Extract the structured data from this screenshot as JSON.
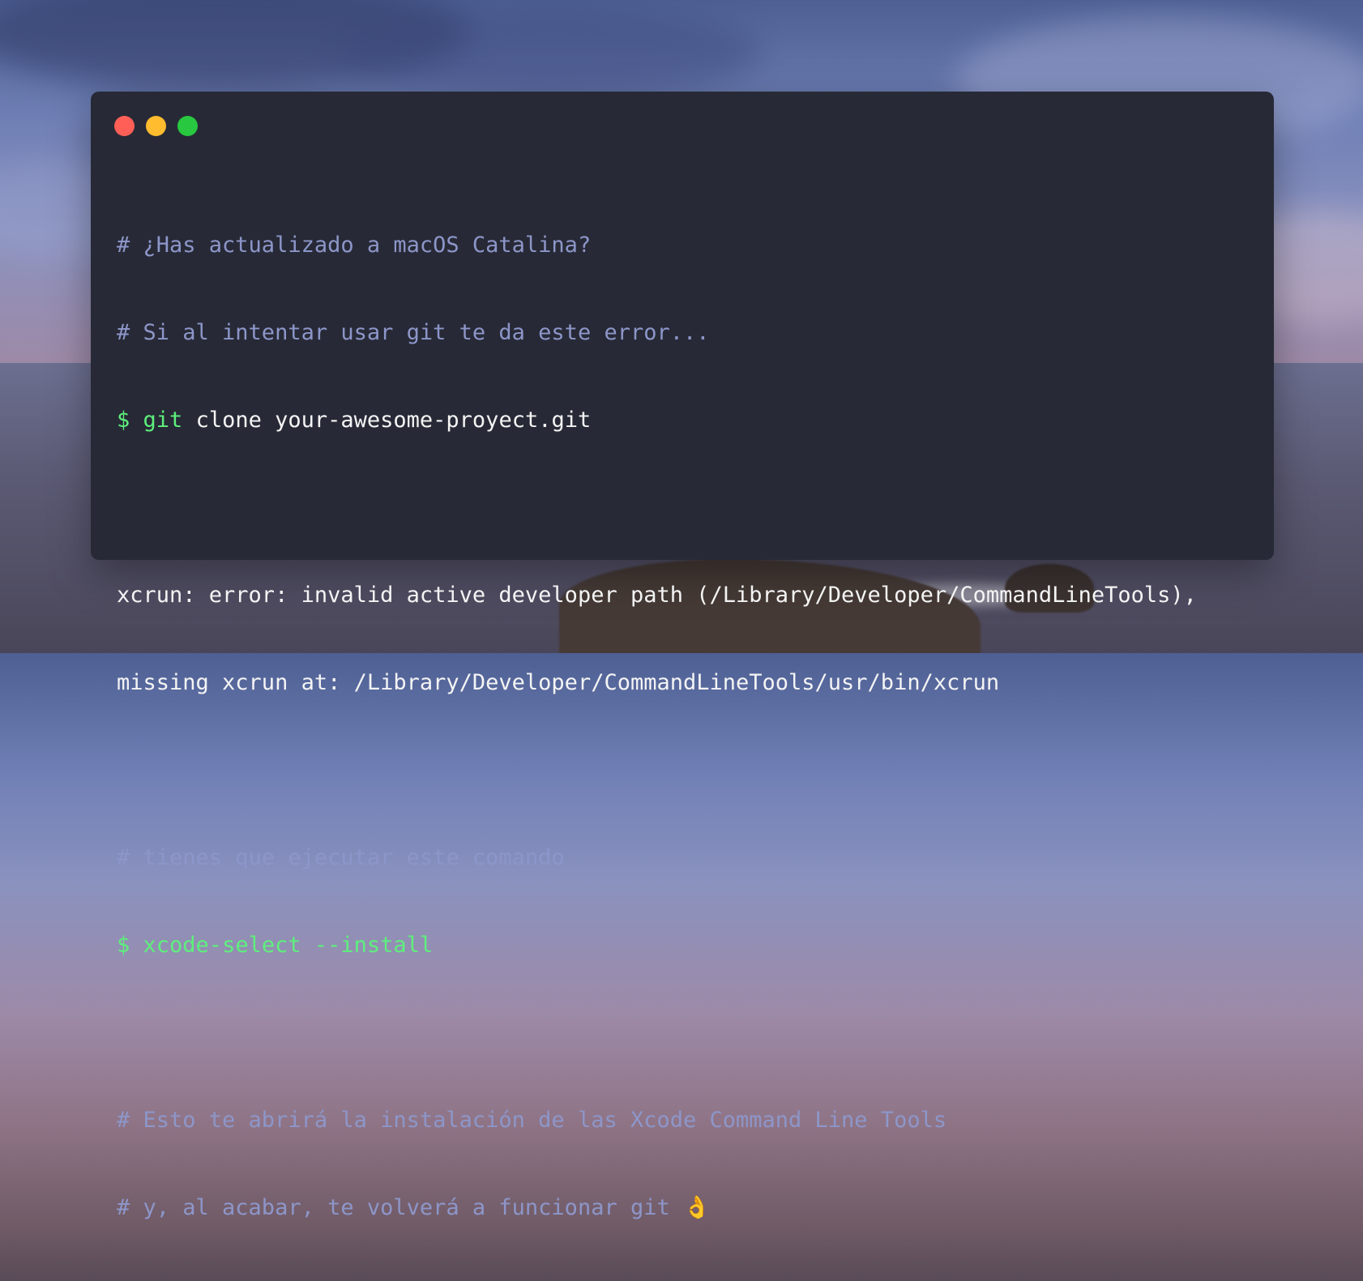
{
  "window": {
    "controls": [
      {
        "name": "close",
        "color": "#ff5f57"
      },
      {
        "name": "minimize",
        "color": "#febc2e"
      },
      {
        "name": "zoom",
        "color": "#28c840"
      }
    ]
  },
  "terminal": {
    "lines": {
      "l1": "# ¿Has actualizado a macOS Catalina?",
      "l2": "# Si al intentar usar git te da este error...",
      "l3_prompt": "$",
      "l3_cmd": "git",
      "l3_rest": " clone your-awesome-proyect.git",
      "l5": "xcrun: error: invalid active developer path (/Library/Developer/CommandLineTools),",
      "l6": "missing xcrun at: /Library/Developer/CommandLineTools/usr/bin/xcrun",
      "l8": "# tienes que ejecutar este comando",
      "l9_prompt": "$",
      "l9_cmd": "xcode-select --install",
      "l11": "# Esto te abrirá la instalación de las Xcode Command Line Tools",
      "l12": "# y, al acabar, te volverá a funcionar git 👌"
    }
  },
  "colors": {
    "terminal_bg": "#272a36",
    "comment": "#8d96c9",
    "command": "#5ef07c",
    "output": "#f4f4f4"
  }
}
